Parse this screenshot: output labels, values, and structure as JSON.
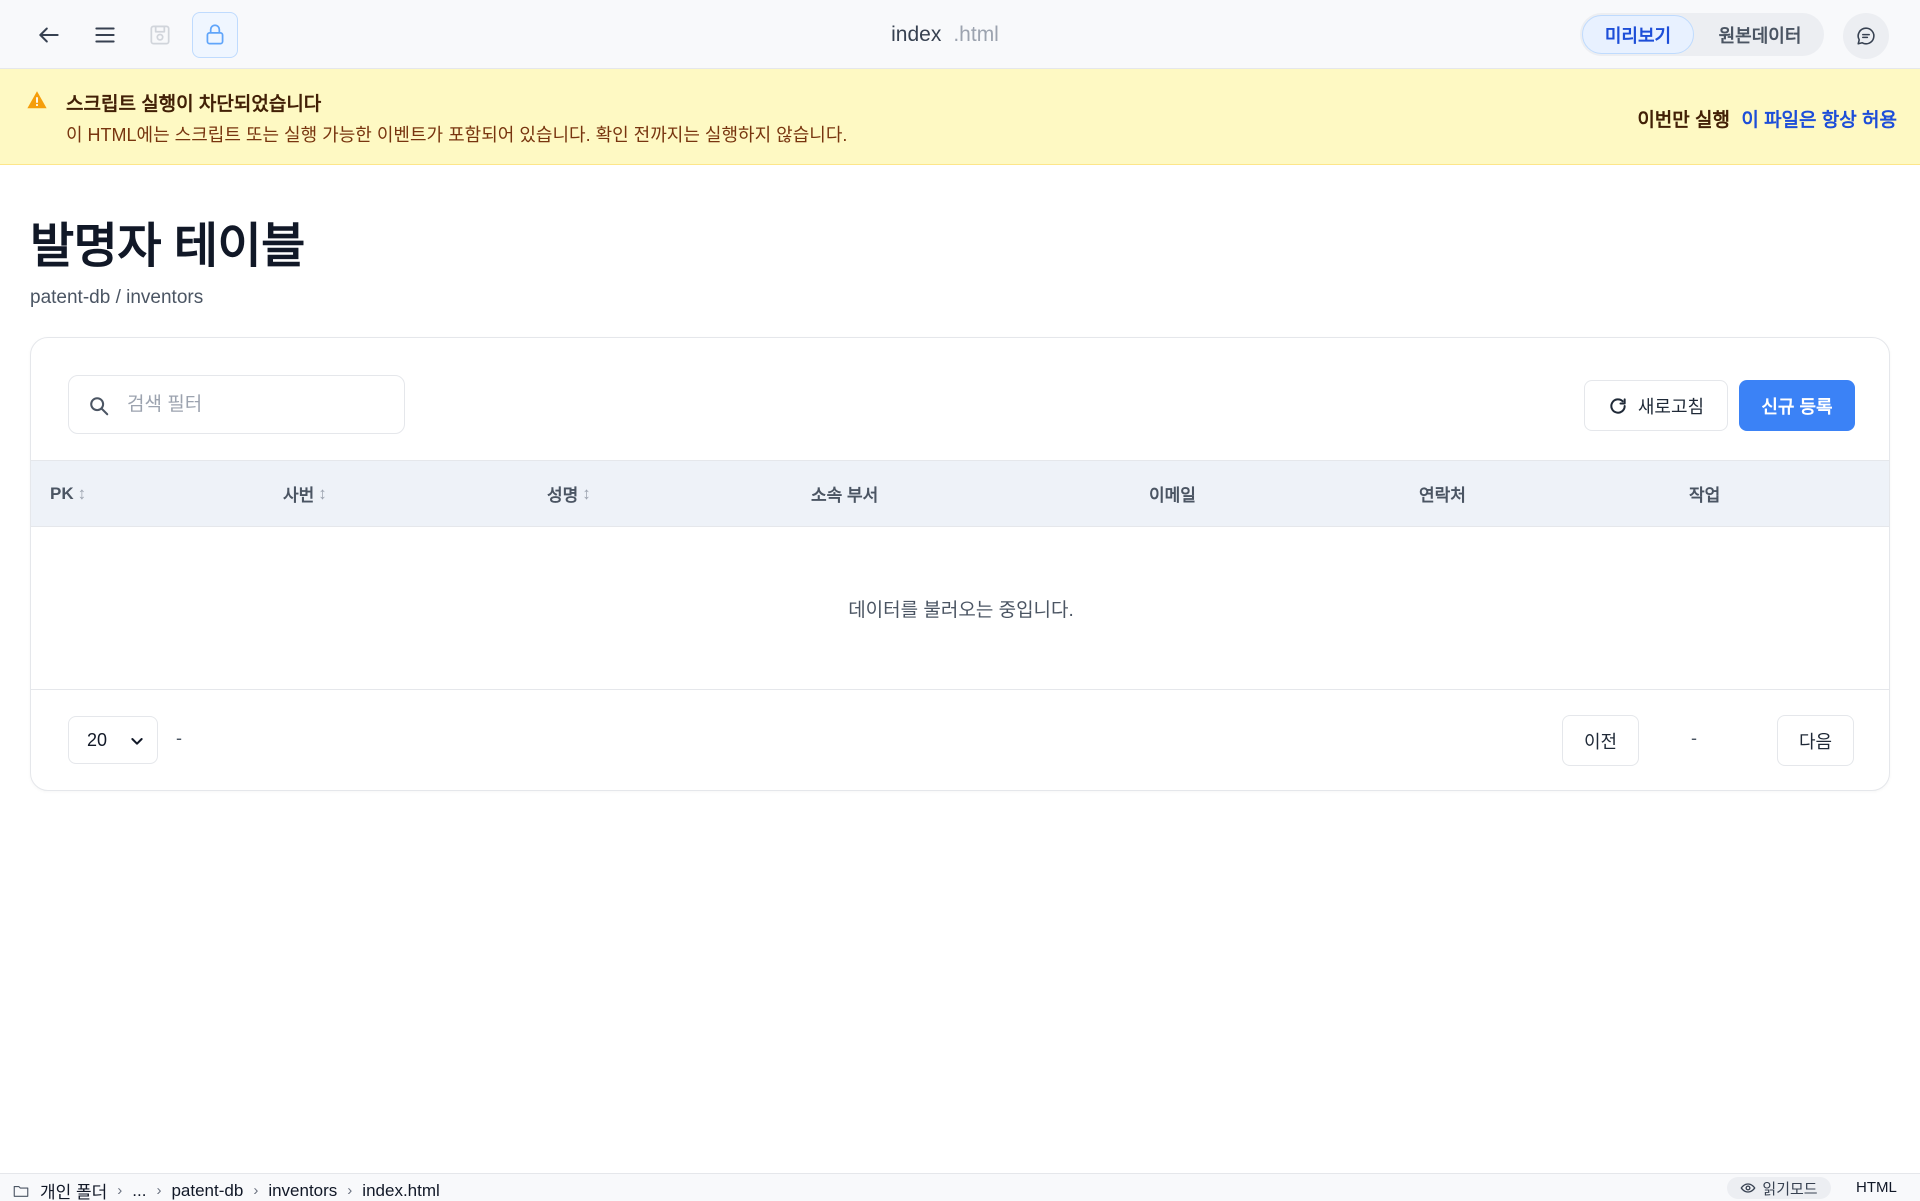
{
  "topbar": {
    "filename": "index",
    "extension": ".html",
    "view_preview": "미리보기",
    "view_source": "원본데이터"
  },
  "banner": {
    "title": "스크립트 실행이 차단되었습니다",
    "message": "이 HTML에는 스크립트 또는 실행 가능한 이벤트가 포함되어 있습니다. 확인 전까지는 실행하지 않습니다.",
    "run_once": "이번만 실행",
    "always_allow": "이 파일은 항상 허용",
    "accent_color": "#fef9c3"
  },
  "page": {
    "title": "발명자 테이블",
    "breadcrumb": "patent-db / inventors"
  },
  "toolbar": {
    "search_placeholder": "검색 필터",
    "refresh_label": "새로고침",
    "new_label": "신규 등록",
    "primary_color": "#3b82f6"
  },
  "table": {
    "columns": [
      {
        "label": "PK",
        "sortable": true
      },
      {
        "label": "사번",
        "sortable": true
      },
      {
        "label": "성명",
        "sortable": true
      },
      {
        "label": "소속 부서",
        "sortable": false
      },
      {
        "label": "이메일",
        "sortable": false
      },
      {
        "label": "연락처",
        "sortable": false
      },
      {
        "label": "작업",
        "sortable": false
      }
    ],
    "sort_glyph": "↕",
    "empty_message": "데이터를 불러오는 중입니다."
  },
  "pagination": {
    "page_size": "20",
    "range_text": "-",
    "prev_label": "이전",
    "page_indicator": "-",
    "next_label": "다음"
  },
  "statusbar": {
    "path": [
      "개인 폴더",
      "...",
      "patent-db",
      "inventors",
      "index.html"
    ],
    "read_mode": "읽기모드",
    "language": "HTML"
  }
}
